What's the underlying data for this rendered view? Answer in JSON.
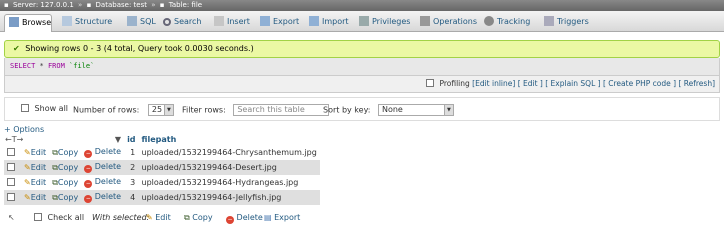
{
  "breadcrumb": {
    "server": "Server: 127.0.0.1",
    "database": "Database: test",
    "table": "Table: file"
  },
  "tabs": [
    {
      "label": "Browse",
      "icon": "browse-icon"
    },
    {
      "label": "Structure",
      "icon": "structure-icon"
    },
    {
      "label": "SQL",
      "icon": "sql-icon"
    },
    {
      "label": "Search",
      "icon": "search-icon"
    },
    {
      "label": "Insert",
      "icon": "insert-icon"
    },
    {
      "label": "Export",
      "icon": "export-icon"
    },
    {
      "label": "Import",
      "icon": "import-icon"
    },
    {
      "label": "Privileges",
      "icon": "privileges-icon"
    },
    {
      "label": "Operations",
      "icon": "operations-icon"
    },
    {
      "label": "Tracking",
      "icon": "tracking-icon"
    },
    {
      "label": "Triggers",
      "icon": "triggers-icon"
    }
  ],
  "result": {
    "message": "Showing rows 0 - 3 (4 total, Query took 0.0030 seconds.)"
  },
  "sql": {
    "select": "SELECT",
    "star": " * ",
    "from": "FROM",
    "table": " `file`"
  },
  "sql_footer": {
    "profiling": "Profiling",
    "edit_inline": "[Edit inline]",
    "edit": "[ Edit ]",
    "explain": "[ Explain SQL ]",
    "php": "[ Create PHP code ]",
    "refresh": "[ Refresh]"
  },
  "nav": {
    "show_all": "Show all",
    "rows_label": "Number of rows:",
    "rows_value": "25",
    "filter_label": "Filter rows:",
    "filter_placeholder": "Search this table",
    "sort_label": "Sort by key:",
    "sort_value": "None"
  },
  "options_link": "+ Options",
  "arrows": "←T→",
  "columns": {
    "id": "id",
    "filepath": "filepath"
  },
  "row_actions": {
    "edit": "Edit",
    "copy": "Copy",
    "delete": "Delete"
  },
  "rows": [
    {
      "id": "1",
      "filepath": "uploaded/1532199464-Chrysanthemum.jpg"
    },
    {
      "id": "2",
      "filepath": "uploaded/1532199464-Desert.jpg"
    },
    {
      "id": "3",
      "filepath": "uploaded/1532199464-Hydrangeas.jpg"
    },
    {
      "id": "4",
      "filepath": "uploaded/1532199464-Jellyfish.jpg"
    }
  ],
  "bulk": {
    "check_all": "Check all",
    "with_selected": "With selected:",
    "edit": "Edit",
    "copy": "Copy",
    "delete": "Delete",
    "export": "Export"
  },
  "colors": {
    "link": "#235a81",
    "success_bg": "#ebf8a4",
    "success_border": "#a2d246",
    "row_alt": "#dfdfdf"
  }
}
